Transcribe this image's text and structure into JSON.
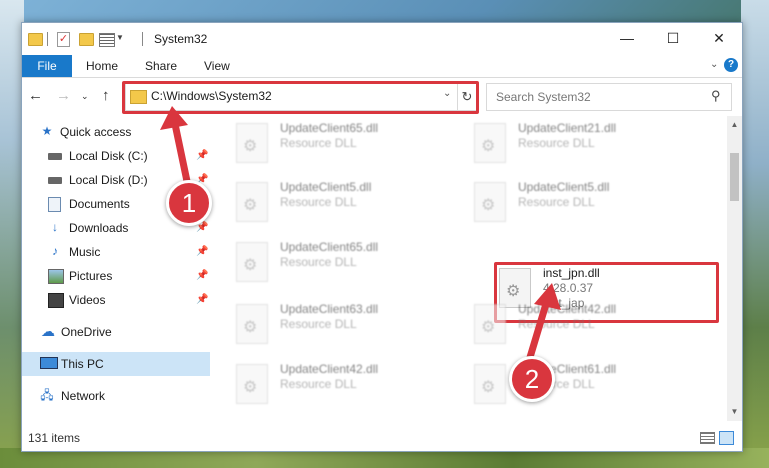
{
  "window": {
    "title": "System32",
    "controls": {
      "minimize": "—",
      "maximize": "☐",
      "close": "✕"
    }
  },
  "ribbon": {
    "tabs": [
      "File",
      "Home",
      "Share",
      "View"
    ],
    "help": "?"
  },
  "address": {
    "path": "C:\\Windows\\System32",
    "search_placeholder": "Search System32"
  },
  "sidebar": {
    "items": [
      {
        "label": "Quick access",
        "icon": "star-icon",
        "pinned": false
      },
      {
        "label": "Local Disk (C:)",
        "icon": "disk-icon",
        "pinned": true
      },
      {
        "label": "Local Disk (D:)",
        "icon": "disk-icon",
        "pinned": true
      },
      {
        "label": "Documents",
        "icon": "documents-icon",
        "pinned": true
      },
      {
        "label": "Downloads",
        "icon": "downloads-icon",
        "pinned": true
      },
      {
        "label": "Music",
        "icon": "music-icon",
        "pinned": true
      },
      {
        "label": "Pictures",
        "icon": "pictures-icon",
        "pinned": true
      },
      {
        "label": "Videos",
        "icon": "videos-icon",
        "pinned": true
      },
      {
        "label": "OneDrive",
        "icon": "onedrive-icon",
        "pinned": false
      },
      {
        "label": "This PC",
        "icon": "this-pc-icon",
        "pinned": false,
        "selected": true
      },
      {
        "label": "Network",
        "icon": "network-icon",
        "pinned": false
      }
    ]
  },
  "files": [
    {
      "name": "UpdateClient65.dll",
      "line2": "Resource DLL",
      "line3": "",
      "blurred": true
    },
    {
      "name": "UpdateClient21.dll",
      "line2": "Resource DLL",
      "line3": "",
      "blurred": true
    },
    {
      "name": "UpdateClient5.dll",
      "line2": "Resource DLL",
      "line3": "",
      "blurred": true
    },
    {
      "name": "UpdateClient5.dll",
      "line2": "Resource DLL",
      "line3": "",
      "blurred": true
    },
    {
      "name": "UpdateClient65.dll",
      "line2": "Resource DLL",
      "line3": "",
      "blurred": true
    },
    {
      "name": "inst_jpn.dll",
      "line2": "4.28.0.37",
      "line3": "inst_jap",
      "blurred": false
    },
    {
      "name": "UpdateClient63.dll",
      "line2": "Resource DLL",
      "line3": "",
      "blurred": true
    },
    {
      "name": "UpdateClient42.dll",
      "line2": "Resource DLL",
      "line3": "",
      "blurred": true
    },
    {
      "name": "UpdateClient42.dll",
      "line2": "Resource DLL",
      "line3": "",
      "blurred": true
    },
    {
      "name": "UpdateClient61.dll",
      "line2": "Resource DLL",
      "line3": "",
      "blurred": true
    }
  ],
  "status": {
    "item_count": "131 items"
  },
  "annotations": {
    "step1": "1",
    "step2": "2",
    "color": "#d9363e"
  }
}
